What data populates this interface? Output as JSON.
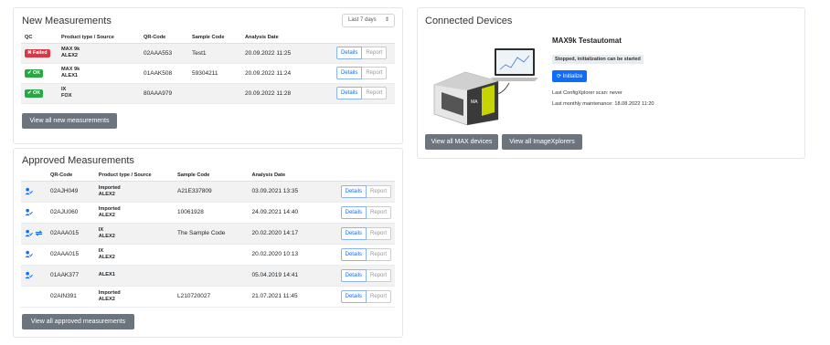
{
  "new_measurements": {
    "title": "New Measurements",
    "filter": "Last 7 days",
    "columns": [
      "QC",
      "Product type / Source",
      "QR-Code",
      "Sample Code",
      "Analysis Date"
    ],
    "rows": [
      {
        "qc": "Failed",
        "qc_status": "fail",
        "product": "MAX 9k",
        "source": "ALEX2",
        "qr": "02AAA553",
        "sample": "Test1",
        "date": "20.09.2022 11:25"
      },
      {
        "qc": "OK",
        "qc_status": "ok",
        "product": "MAX 9k",
        "source": "ALEX1",
        "qr": "01AAK508",
        "sample": "59304211",
        "date": "20.09.2022 11:24"
      },
      {
        "qc": "OK",
        "qc_status": "ok",
        "product": "IX",
        "source": "FOX",
        "qr": "80AAA979",
        "sample": "",
        "date": "20.09.2022 11:28"
      }
    ],
    "details_label": "Details",
    "report_label": "Report",
    "view_all_label": "View all new measurements"
  },
  "approved_measurements": {
    "title": "Approved Measurements",
    "columns": [
      "QR-Code",
      "Product type / Source",
      "Sample Code",
      "Analysis Date"
    ],
    "rows": [
      {
        "icons": [
          "user-check-icon"
        ],
        "qr": "02AJH049",
        "product": "Imported",
        "source": "ALEX2",
        "sample": "A21E337809",
        "date": "03.09.2021 13:35"
      },
      {
        "icons": [
          "user-check-icon"
        ],
        "qr": "02AJU060",
        "product": "Imported",
        "source": "ALEX2",
        "sample": "10061928",
        "date": "24.09.2021 14:40"
      },
      {
        "icons": [
          "user-check-icon",
          "transfer-icon"
        ],
        "qr": "02AAA015",
        "product": "IX",
        "source": "ALEX2",
        "sample": "The Sample Code",
        "date": "20.02.2020 14:17"
      },
      {
        "icons": [
          "user-check-icon"
        ],
        "qr": "02AAA015",
        "product": "IX",
        "source": "ALEX2",
        "sample": "",
        "date": "20.02.2020 10:13"
      },
      {
        "icons": [
          "user-check-icon"
        ],
        "qr": "01AAK377",
        "product": "",
        "source": "ALEX1",
        "sample": "",
        "date": "05.04.2019 14:41"
      },
      {
        "icons": [],
        "qr": "02AIN391",
        "product": "Imported",
        "source": "ALEX2",
        "sample": "L210720027",
        "date": "21.07.2021 11:45"
      }
    ],
    "details_label": "Details",
    "report_label": "Report",
    "view_all_label": "View all approved measurements"
  },
  "connected_devices": {
    "title": "Connected Devices",
    "device_name": "MAX9k Testautomat",
    "status": "Stopped, initialization can be started",
    "initialize_label": "Initialize",
    "last_scan": "Last ConfigXplorer scan: never",
    "last_maintenance": "Last monthly maintenance: 18.08.2022 11:20",
    "view_max_label": "View all MAX devices",
    "view_ix_label": "View all ImageXplorers"
  },
  "colors": {
    "primary": "#0d6efd",
    "failed": "#dc3545",
    "ok": "#28a745",
    "secondary_button": "#6c757d"
  }
}
